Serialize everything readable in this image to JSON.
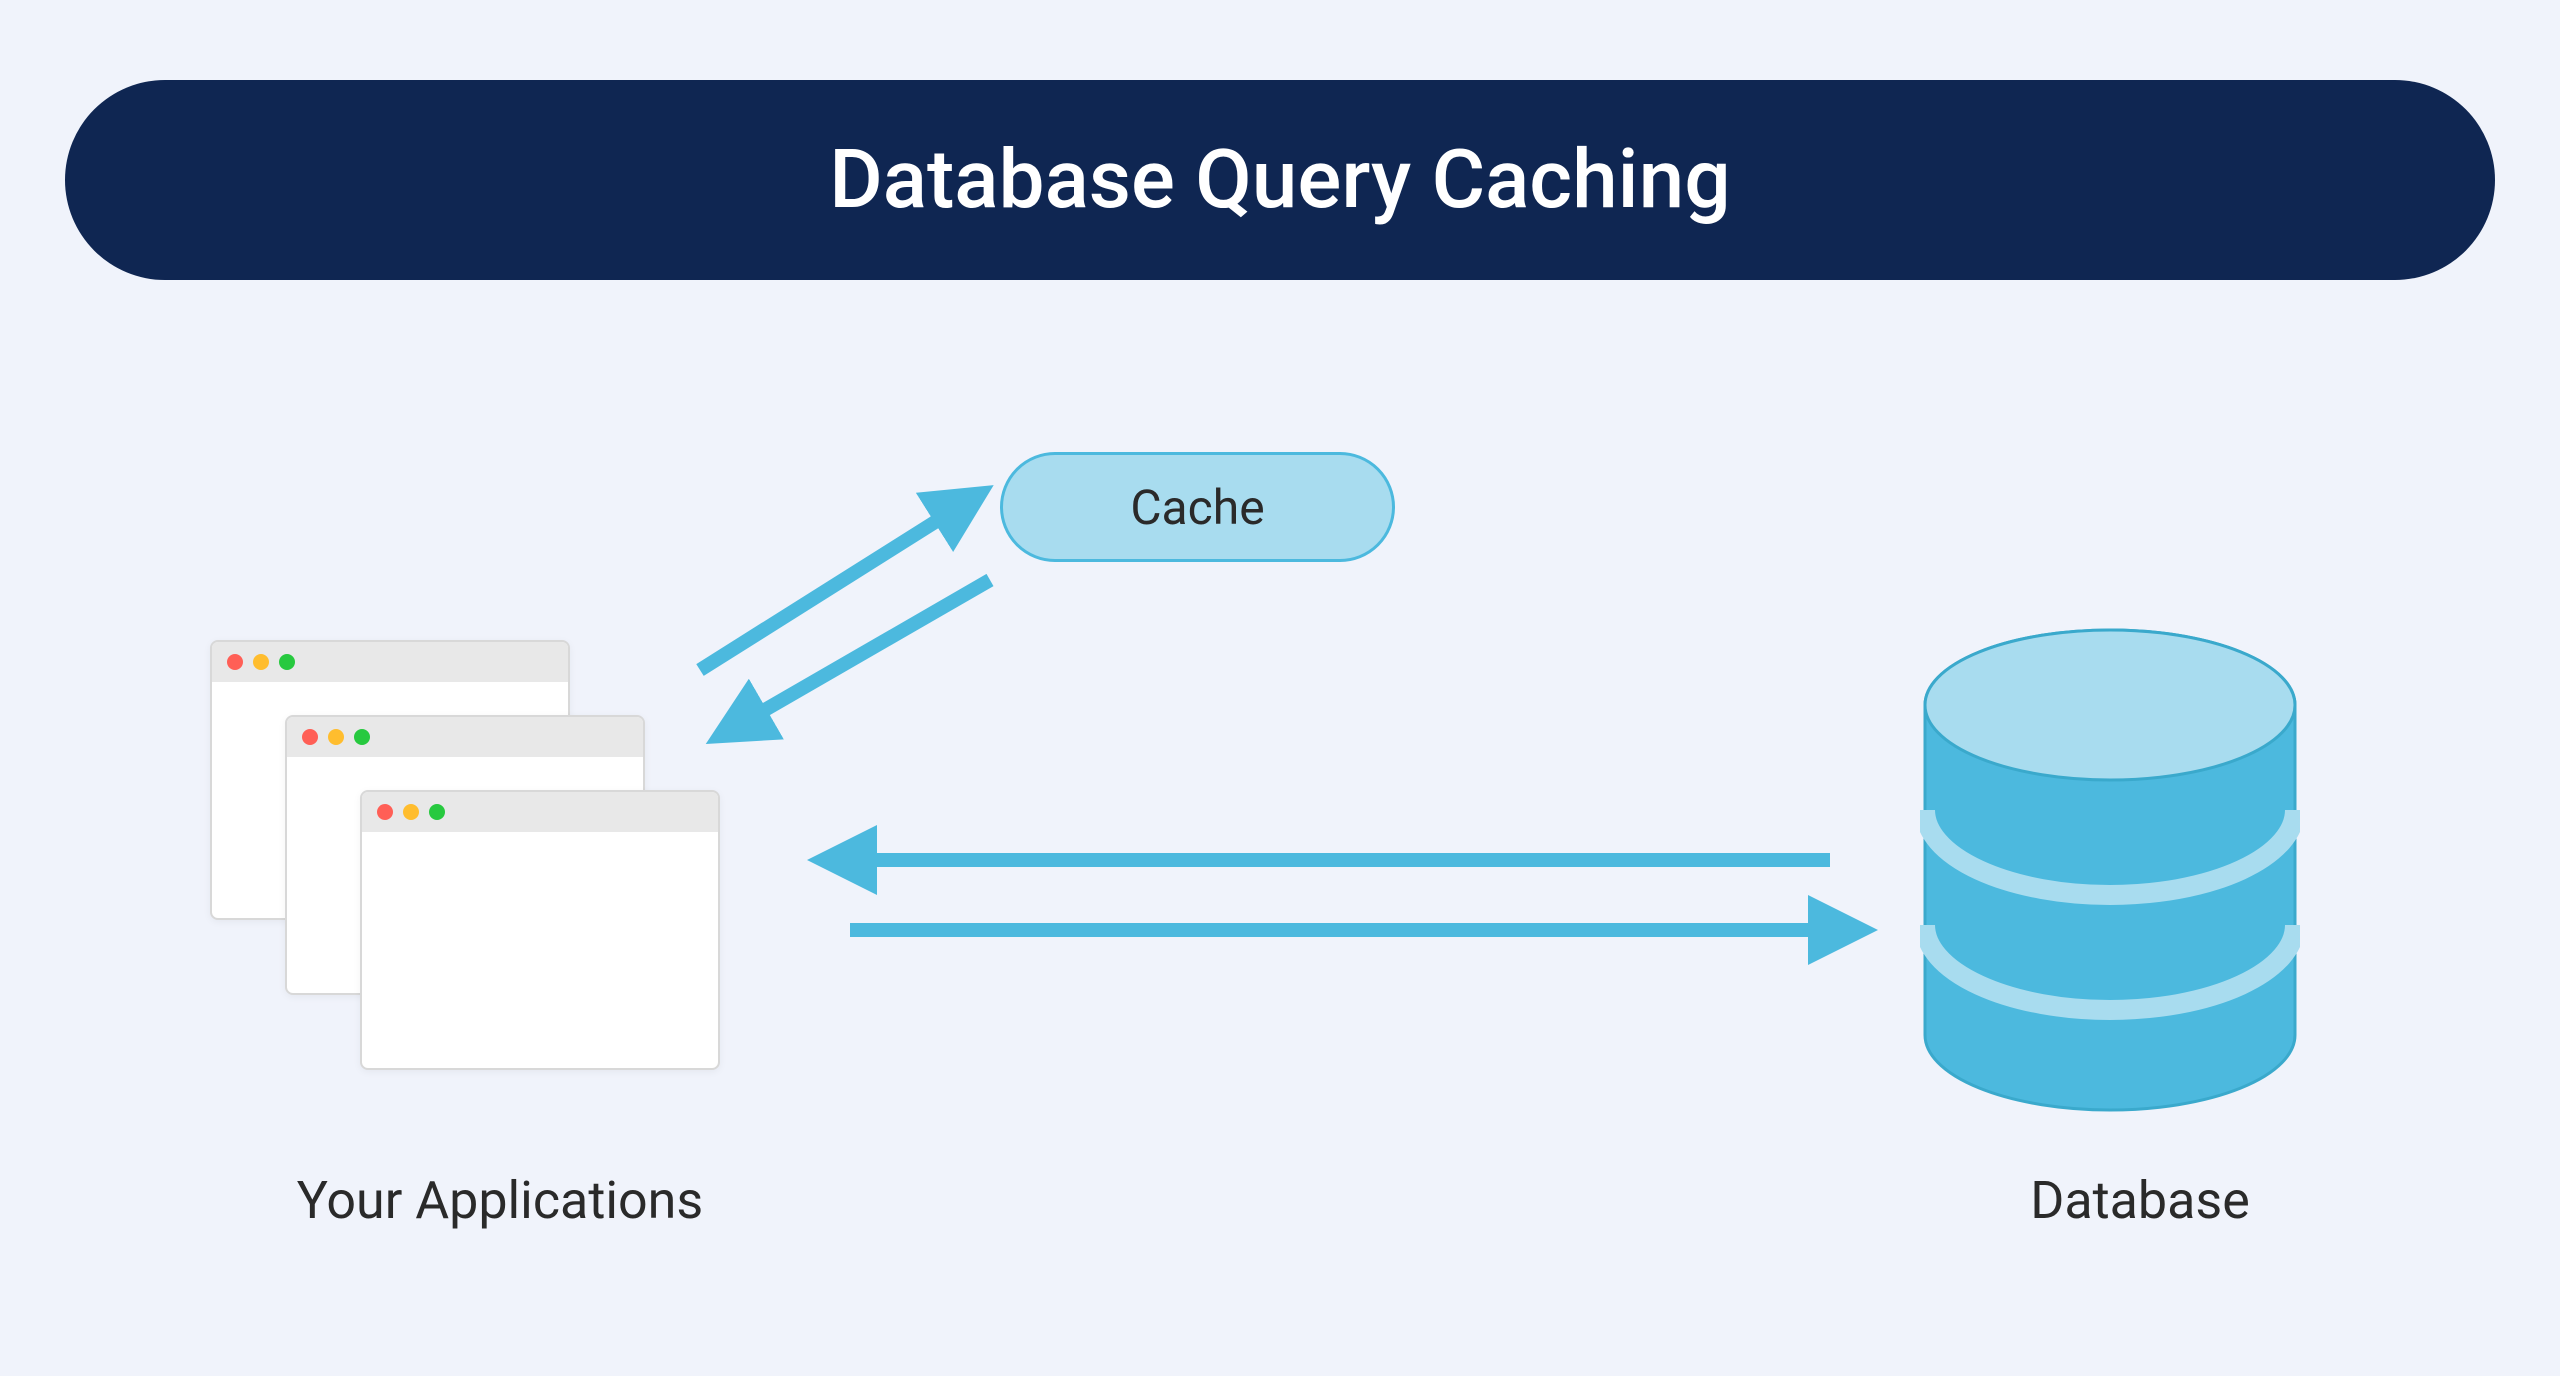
{
  "title": "Database Query Caching",
  "nodes": {
    "cache_label": "Cache",
    "applications_label": "Your Applications",
    "database_label": "Database"
  },
  "colors": {
    "title_bg": "#0f2652",
    "title_text": "#ffffff",
    "page_bg": "#f0f3fb",
    "cache_fill": "#a8dcef",
    "cache_stroke": "#4cb9de",
    "arrow": "#4cb9de",
    "db_fill": "#4cb9de",
    "db_top": "#a8dcef",
    "db_stroke": "#3aa9cc"
  },
  "diagram": {
    "connections": [
      {
        "from": "applications",
        "to": "cache",
        "bidirectional": true
      },
      {
        "from": "applications",
        "to": "database",
        "bidirectional": true
      }
    ]
  }
}
